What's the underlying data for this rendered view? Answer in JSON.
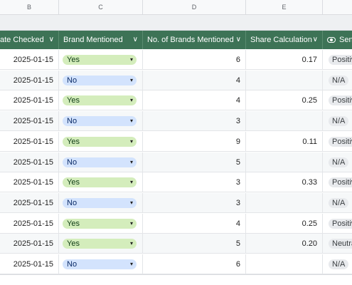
{
  "column_letters": [
    "B",
    "C",
    "D",
    "E",
    ""
  ],
  "headers": {
    "date_checked": "ate Checked",
    "brand_mentioned": "Brand Mentioned",
    "num_brands": "No. of Brands Mentioned",
    "share_calc": "Share Calculation",
    "sentiment": "Sen",
    "chevron": "∨"
  },
  "colors": {
    "header_bg": "#3d7356",
    "yes_chip": "#d4edbc",
    "no_chip": "#d3e3fd",
    "sentiment_chip": "#e8eaed"
  },
  "icons": {
    "sentiment_header": "sentiment-lens-icon",
    "dropdown": "caret-down-icon"
  },
  "caret": "▾",
  "rows": [
    {
      "date": "2025-01-15",
      "brand": "Yes",
      "count": "6",
      "share": "0.17",
      "sentiment": "Positiv"
    },
    {
      "date": "2025-01-15",
      "brand": "No",
      "count": "4",
      "share": "",
      "sentiment": "N/A"
    },
    {
      "date": "2025-01-15",
      "brand": "Yes",
      "count": "4",
      "share": "0.25",
      "sentiment": "Positiv"
    },
    {
      "date": "2025-01-15",
      "brand": "No",
      "count": "3",
      "share": "",
      "sentiment": "N/A"
    },
    {
      "date": "2025-01-15",
      "brand": "Yes",
      "count": "9",
      "share": "0.11",
      "sentiment": "Positiv"
    },
    {
      "date": "2025-01-15",
      "brand": "No",
      "count": "5",
      "share": "",
      "sentiment": "N/A"
    },
    {
      "date": "2025-01-15",
      "brand": "Yes",
      "count": "3",
      "share": "0.33",
      "sentiment": "Positiv"
    },
    {
      "date": "2025-01-15",
      "brand": "No",
      "count": "3",
      "share": "",
      "sentiment": "N/A"
    },
    {
      "date": "2025-01-15",
      "brand": "Yes",
      "count": "4",
      "share": "0.25",
      "sentiment": "Positiv"
    },
    {
      "date": "2025-01-15",
      "brand": "Yes",
      "count": "5",
      "share": "0.20",
      "sentiment": "Neutra"
    },
    {
      "date": "2025-01-15",
      "brand": "No",
      "count": "6",
      "share": "",
      "sentiment": "N/A"
    }
  ]
}
